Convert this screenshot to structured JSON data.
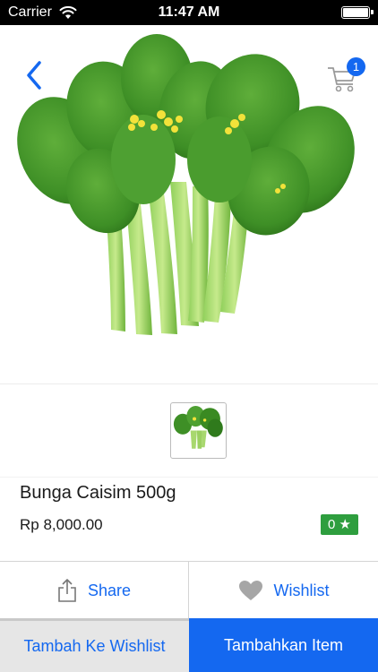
{
  "status_bar": {
    "carrier": "Carrier",
    "time": "11:47 AM"
  },
  "nav": {
    "back_icon": "chevron-left-icon",
    "cart_icon": "cart-icon",
    "cart_count": "1"
  },
  "product": {
    "name": "Bunga Caisim 500g",
    "price": "Rp 8,000.00",
    "rating": "0 ★"
  },
  "actions": {
    "share_label": "Share",
    "wishlist_label": "Wishlist"
  },
  "bottom": {
    "add_wishlist_label": "Tambah Ke Wishlist",
    "add_item_label": "Tambahkan Item"
  },
  "colors": {
    "accent": "#1468f0",
    "rating_badge": "#2e9e3e",
    "status_bar": "#000000"
  }
}
